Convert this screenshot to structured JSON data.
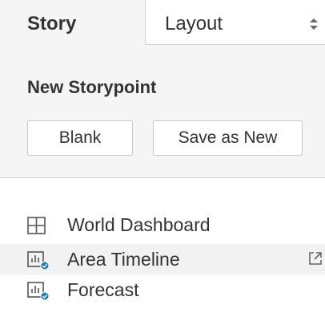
{
  "tabs": {
    "story_label": "Story",
    "layout_label": "Layout"
  },
  "panel": {
    "title": "New Storypoint",
    "blank_button": "Blank",
    "save_button": "Save as New"
  },
  "storypoints": [
    {
      "label": "World Dashboard",
      "icon": "dashboard-grid-icon",
      "selected": false
    },
    {
      "label": "Area Timeline",
      "icon": "worksheet-chart-icon",
      "selected": true,
      "external_link_icon": "open-external-icon"
    },
    {
      "label": "Forecast",
      "icon": "worksheet-chart-icon",
      "selected": false
    }
  ],
  "colors": {
    "panel_bg": "#f5f5f5",
    "text": "#333333",
    "accent_badge": "#1f77b4"
  }
}
